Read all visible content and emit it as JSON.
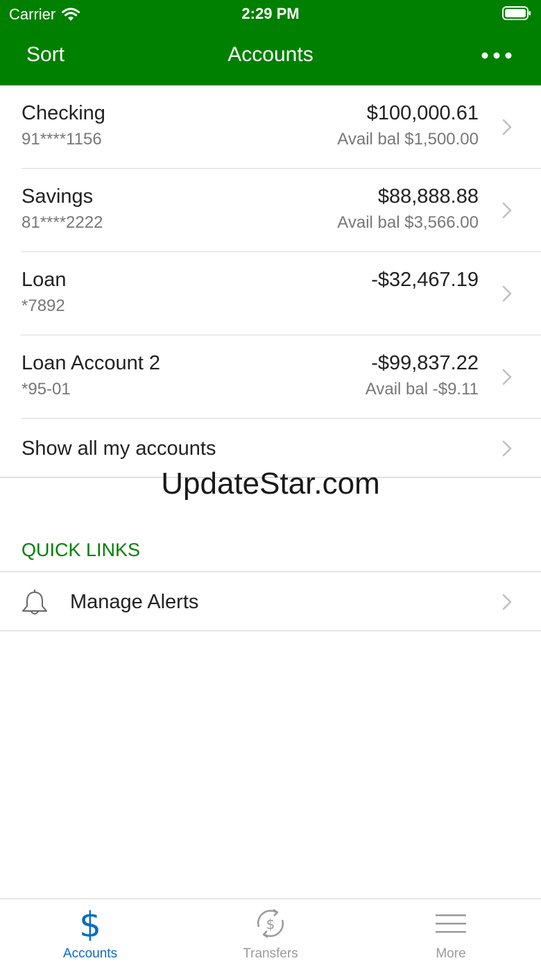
{
  "status_bar": {
    "carrier": "Carrier",
    "time": "2:29 PM"
  },
  "nav": {
    "sort_label": "Sort",
    "title": "Accounts"
  },
  "accounts": [
    {
      "name": "Checking",
      "number": "91****1156",
      "balance": "$100,000.61",
      "avail": "Avail bal $1,500.00"
    },
    {
      "name": "Savings",
      "number": "81****2222",
      "balance": "$88,888.88",
      "avail": "Avail bal $3,566.00"
    },
    {
      "name": "Loan",
      "number": "*7892",
      "balance": "-$32,467.19",
      "avail": ""
    },
    {
      "name": "Loan Account 2",
      "number": "*95-01",
      "balance": "-$99,837.22",
      "avail": "Avail bal -$9.11"
    }
  ],
  "show_all_label": "Show all my accounts",
  "watermark": "UpdateStar.com",
  "quick_links": {
    "header": "QUICK LINKS",
    "items": [
      {
        "label": "Manage Alerts",
        "icon": "bell-icon"
      }
    ]
  },
  "tabs": [
    {
      "label": "Accounts",
      "icon": "dollar-icon",
      "active": true
    },
    {
      "label": "Transfers",
      "icon": "transfer-dollar-icon",
      "active": false
    },
    {
      "label": "More",
      "icon": "hamburger-icon",
      "active": false
    }
  ],
  "colors": {
    "brand_green": "#008000",
    "active_tab": "#0a6cc4",
    "inactive_tab": "#9a9a9a"
  }
}
